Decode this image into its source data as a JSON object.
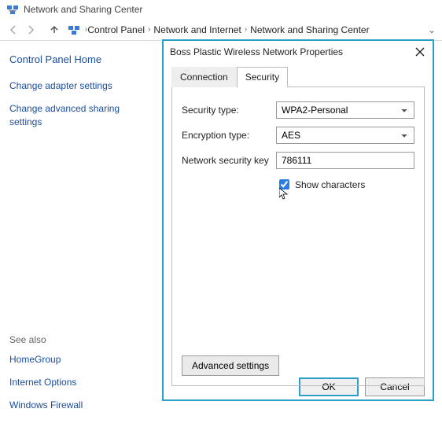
{
  "window": {
    "title": "Network and Sharing Center"
  },
  "breadcrumb": {
    "items": [
      "Control Panel",
      "Network and Internet",
      "Network and Sharing Center"
    ]
  },
  "sidebar": {
    "heading": "Control Panel Home",
    "links": {
      "adapter": "Change adapter settings",
      "advanced": "Change advanced sharing settings"
    },
    "see_also_label": "See also",
    "see_also": {
      "homegroup": "HomeGroup",
      "internet_options": "Internet Options",
      "firewall": "Windows Firewall"
    }
  },
  "dialog": {
    "title": "Boss Plastic Wireless Network Properties",
    "tabs": {
      "connection": "Connection",
      "security": "Security"
    },
    "security": {
      "security_type_label": "Security type:",
      "security_type_value": "WPA2-Personal",
      "encryption_type_label": "Encryption type:",
      "encryption_type_value": "AES",
      "network_key_label": "Network security key",
      "network_key_value": "786111",
      "show_characters_label": "Show characters",
      "show_characters_checked": true,
      "advanced_button": "Advanced settings"
    },
    "buttons": {
      "ok": "OK",
      "cancel": "Cancel"
    }
  }
}
